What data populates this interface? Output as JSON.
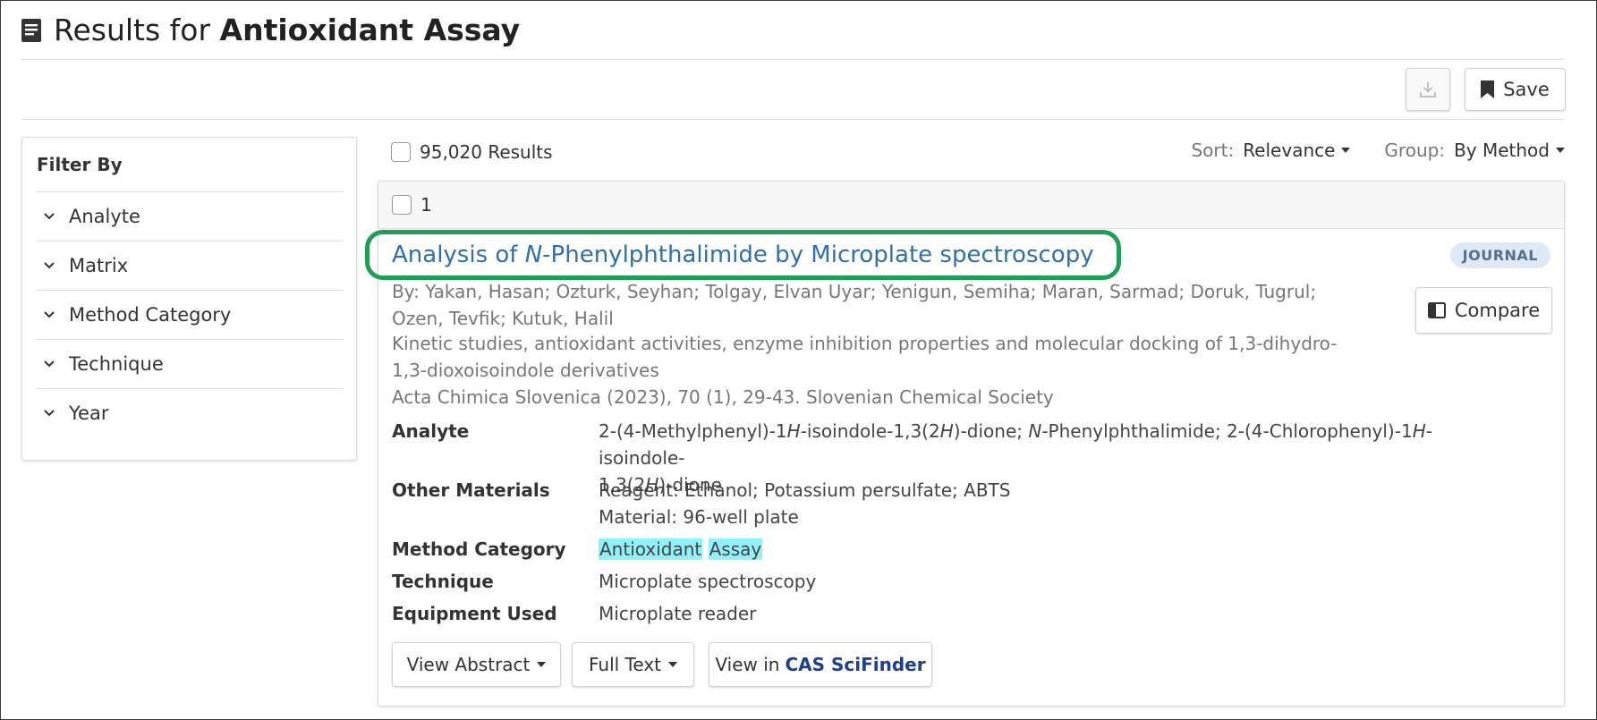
{
  "header": {
    "title_prefix": "Results for",
    "title_query": "Antioxidant Assay",
    "save_label": "Save"
  },
  "sidebar": {
    "title": "Filter By",
    "items": [
      {
        "label": "Analyte"
      },
      {
        "label": "Matrix"
      },
      {
        "label": "Method Category"
      },
      {
        "label": "Technique"
      },
      {
        "label": "Year"
      }
    ]
  },
  "results": {
    "count_label": "95,020 Results",
    "sort_label": "Sort:",
    "sort_value": "Relevance",
    "group_label": "Group:",
    "group_value": "By Method"
  },
  "result_card": {
    "index": "1",
    "title_pre": "Analysis of ",
    "title_italic": "N",
    "title_post": "-Phenylphthalimide by Microplate spectroscopy",
    "badge": "JOURNAL",
    "compare_label": "Compare",
    "authors": "By: Yakan, Hasan; Ozturk, Seyhan; Tolgay, Elvan Uyar; Yenigun, Semiha; Maran, Sarmad; Doruk, Tugrul; Ozen, Tevfik; Kutuk, Halil",
    "article_title": "Kinetic studies, antioxidant activities, enzyme inhibition properties and molecular docking of 1,3-dihydro-1,3-dioxoisoindole derivatives",
    "journal_ref": "Acta Chimica Slovenica (2023), 70 (1), 29-43. Slovenian Chemical Society",
    "fields": {
      "analyte_label": "Analyte",
      "analyte_value": {
        "a": "2-(4-Methylphenyl)-1",
        "b": "H",
        "c": "-isoindole-1,3(2",
        "d": "H",
        "e": ")-dione; ",
        "f": "N",
        "g": "-Phenylphthalimide; 2-(4-Chlorophenyl)-1",
        "h": "H",
        "i": "-isoindole-",
        "j": "1,3(2",
        "k": "H",
        "l": ")-dione"
      },
      "other_materials_label": "Other Materials",
      "other_materials_line1": "Reagent: Ethanol; Potassium persulfate; ABTS",
      "other_materials_line2": "Material: 96-well plate",
      "method_category_label": "Method Category",
      "method_category_word1": "Antioxidant",
      "method_category_word2": "Assay",
      "technique_label": "Technique",
      "technique_value": "Microplate spectroscopy",
      "equipment_label": "Equipment Used",
      "equipment_value": "Microplate reader"
    },
    "actions": {
      "view_abstract": "View Abstract",
      "full_text": "Full Text",
      "view_in": "View in",
      "cas_scifinder": "CAS SciFinder"
    }
  },
  "colors": {
    "link_blue": "#2f6fad",
    "highlight_green": "#1f9e57",
    "search_highlight": "#8ff2fb",
    "badge_bg": "#dde9f5"
  }
}
